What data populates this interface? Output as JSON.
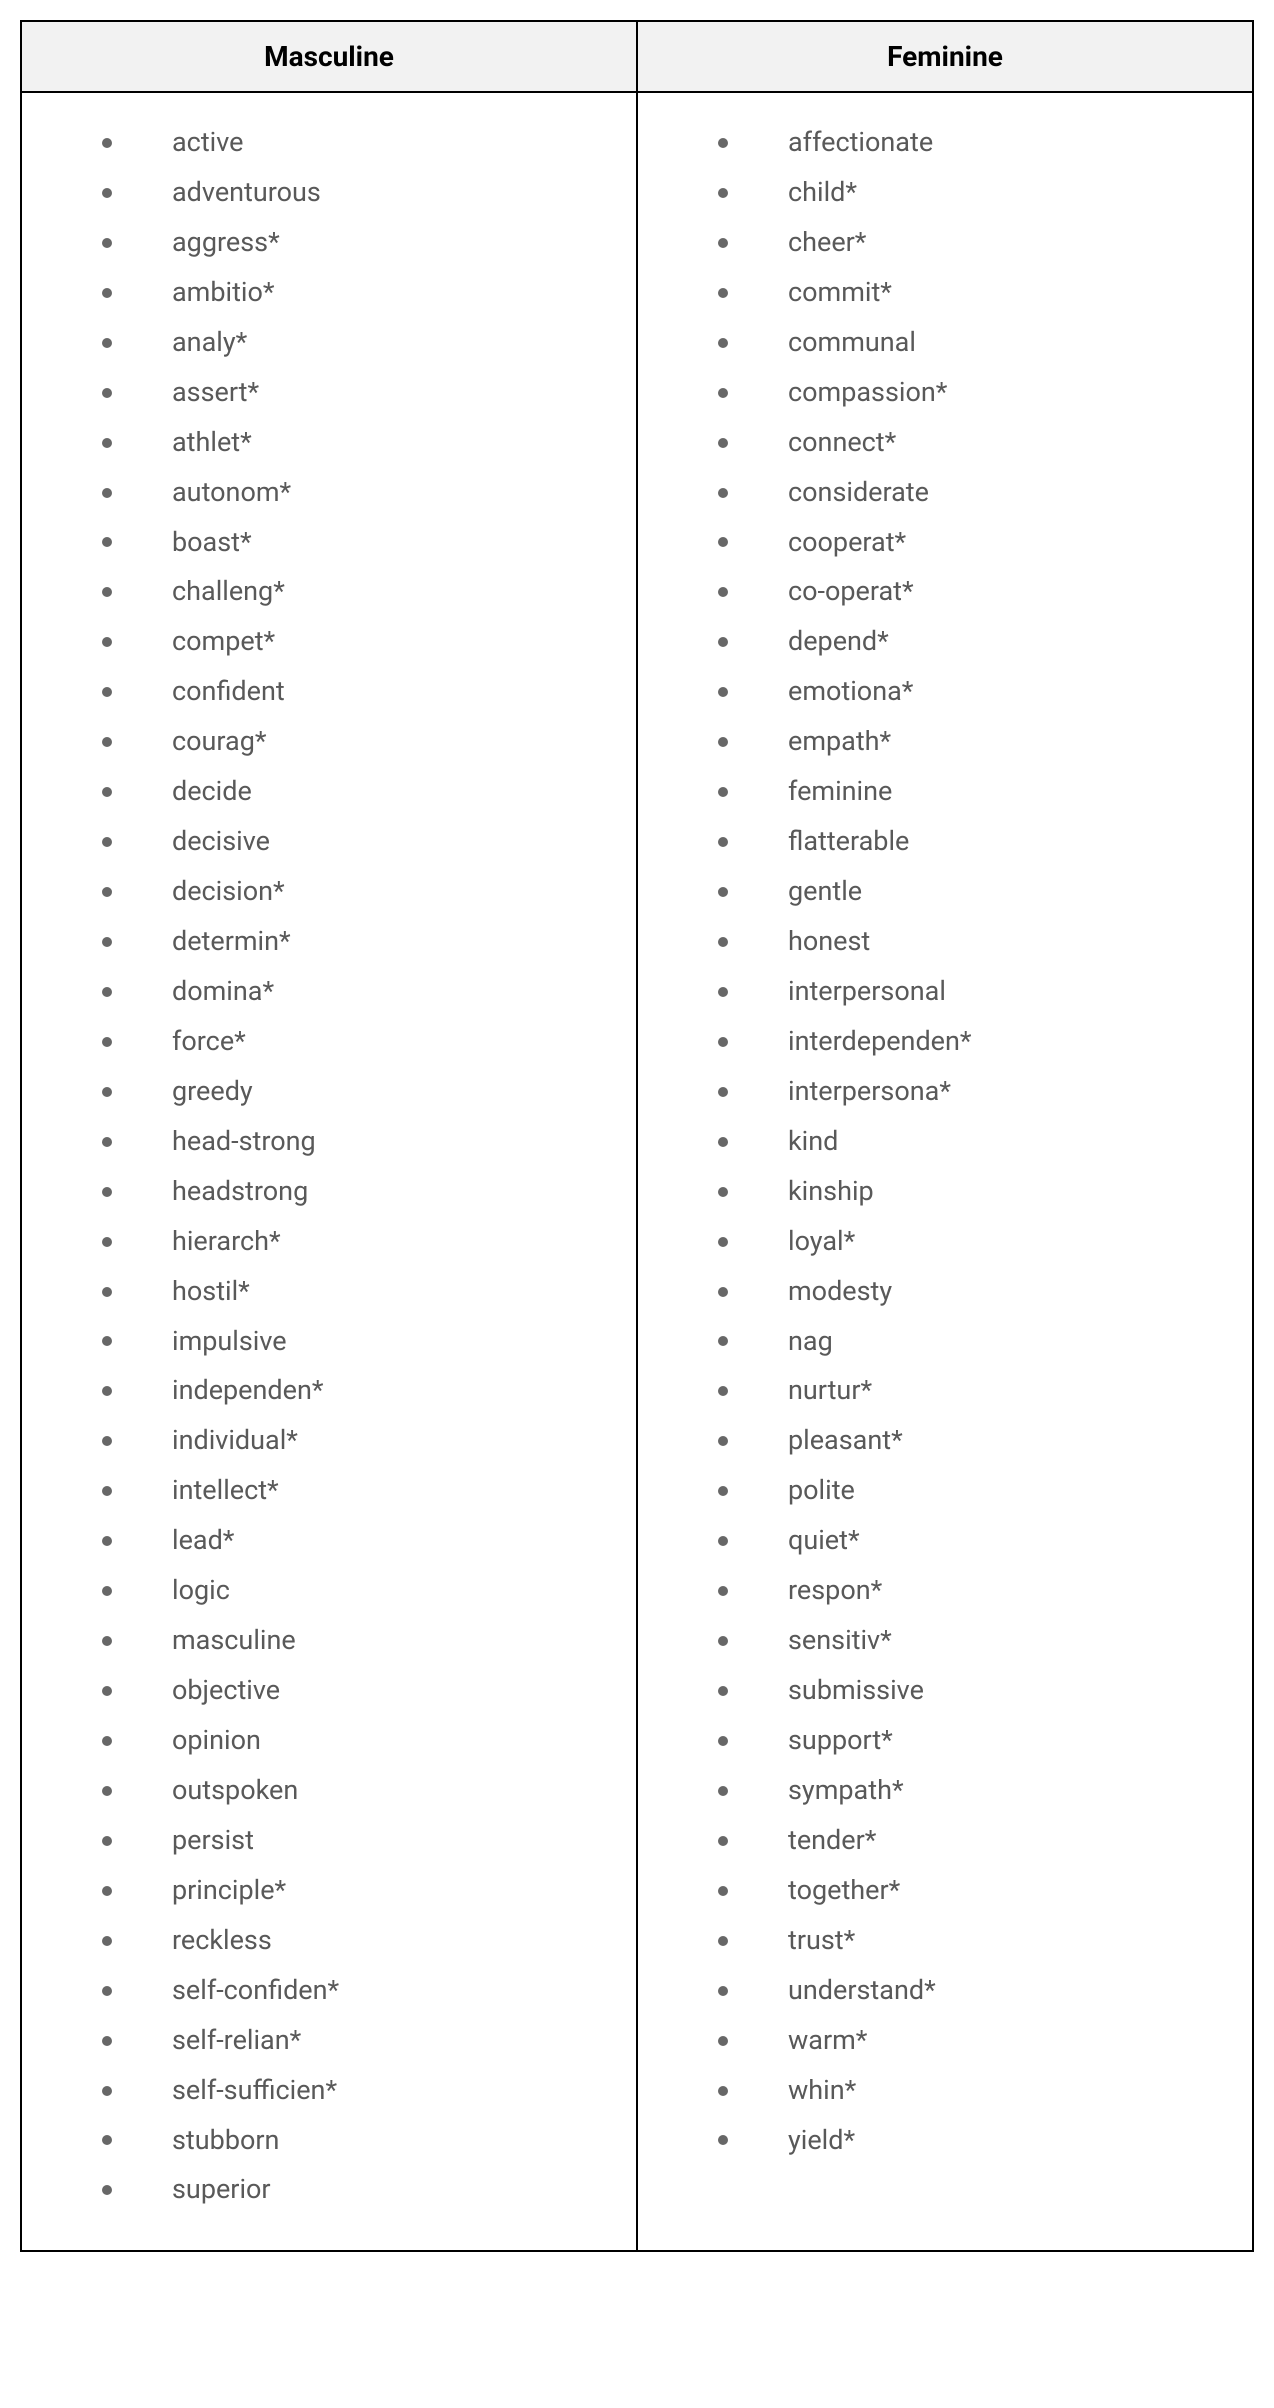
{
  "headers": {
    "col1": "Masculine",
    "col2": "Feminine"
  },
  "columns": {
    "masculine": [
      "active",
      "adventurous",
      "aggress*",
      "ambitio*",
      "analy*",
      "assert*",
      "athlet*",
      "autonom*",
      "boast*",
      "challeng*",
      "compet*",
      "confident",
      "courag*",
      "decide",
      "decisive",
      "decision*",
      "determin*",
      "domina*",
      "force*",
      "greedy",
      "head-strong",
      "headstrong",
      "hierarch*",
      "hostil*",
      "impulsive",
      "independen*",
      "individual*",
      "intellect*",
      "lead*",
      "logic",
      "masculine",
      "objective",
      "opinion",
      "outspoken",
      "persist",
      "principle*",
      "reckless",
      "self-confiden*",
      "self-relian*",
      "self-sufficien*",
      "stubborn",
      "superior"
    ],
    "feminine": [
      "affectionate",
      "child*",
      "cheer*",
      "commit*",
      "communal",
      "compassion*",
      "connect*",
      "considerate",
      "cooperat*",
      "co-operat*",
      "depend*",
      "emotiona*",
      "empath*",
      "feminine",
      "flatterable",
      "gentle",
      "honest",
      "interpersonal",
      "interdependen*",
      "interpersona*",
      "kind",
      "kinship",
      "loyal*",
      "modesty",
      "nag",
      "nurtur*",
      "pleasant*",
      "polite",
      "quiet*",
      "respon*",
      "sensitiv*",
      "submissive",
      "support*",
      "sympath*",
      "tender*",
      "together*",
      "trust*",
      "understand*",
      "warm*",
      "whin*",
      "yield*"
    ]
  }
}
